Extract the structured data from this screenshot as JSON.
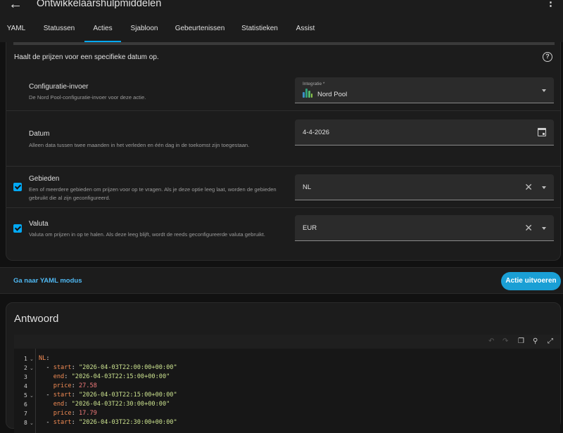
{
  "header": {
    "title": "Ontwikkelaarshulpmiddelen",
    "back_icon": "arrow-left-icon",
    "more_icon": "more-vertical-icon"
  },
  "tabs": [
    {
      "label": "YAML"
    },
    {
      "label": "Statussen"
    },
    {
      "label": "Acties",
      "active": true
    },
    {
      "label": "Sjabloon"
    },
    {
      "label": "Gebeurtenissen"
    },
    {
      "label": "Statistieken"
    },
    {
      "label": "Assist"
    }
  ],
  "action": {
    "description": "Haalt de prijzen voor een specifieke datum op.",
    "fields": {
      "config": {
        "label": "Configuratie-invoer",
        "sub": "De Nord Pool-configuratie-invoer voor deze actie.",
        "float_label": "Integratie *",
        "value": "Nord Pool"
      },
      "date": {
        "label": "Datum",
        "sub": "Alleen data tussen twee maanden in het verleden en één dag in de toekomst zijn toegestaan.",
        "value": "4-4-2026"
      },
      "areas": {
        "label": "Gebieden",
        "sub": "Een of meerdere gebieden om prijzen voor op te vragen. Als je deze optie leeg laat, worden de gebieden gebruikt die al zijn geconfigureerd.",
        "value": "NL",
        "checked": true
      },
      "currency": {
        "label": "Valuta",
        "sub": "Valuta om prijzen in op te halen. Als deze leeg blijft, wordt de reeds geconfigureerde valuta gebruikt.",
        "value": "EUR",
        "checked": true
      }
    }
  },
  "footer": {
    "yaml_link": "Ga naar YAML modus",
    "run_button": "Actie uitvoeren"
  },
  "response": {
    "title": "Antwoord",
    "lines": [
      {
        "n": "1",
        "fold": true,
        "parts": [
          {
            "c": "k",
            "t": "NL"
          },
          {
            "c": "",
            "t": ":"
          }
        ]
      },
      {
        "n": "2",
        "fold": true,
        "parts": [
          {
            "c": "",
            "t": "  - "
          },
          {
            "c": "k",
            "t": "start"
          },
          {
            "c": "",
            "t": ": "
          },
          {
            "c": "s",
            "t": "\"2026-04-03T22:00:00+00:00\""
          }
        ]
      },
      {
        "n": "3",
        "fold": false,
        "parts": [
          {
            "c": "",
            "t": "    "
          },
          {
            "c": "k",
            "t": "end"
          },
          {
            "c": "",
            "t": ": "
          },
          {
            "c": "s",
            "t": "\"2026-04-03T22:15:00+00:00\""
          }
        ]
      },
      {
        "n": "4",
        "fold": false,
        "parts": [
          {
            "c": "",
            "t": "    "
          },
          {
            "c": "k",
            "t": "price"
          },
          {
            "c": "",
            "t": ": "
          },
          {
            "c": "n",
            "t": "27.58"
          }
        ]
      },
      {
        "n": "5",
        "fold": true,
        "parts": [
          {
            "c": "",
            "t": "  - "
          },
          {
            "c": "k",
            "t": "start"
          },
          {
            "c": "",
            "t": ": "
          },
          {
            "c": "s",
            "t": "\"2026-04-03T22:15:00+00:00\""
          }
        ]
      },
      {
        "n": "6",
        "fold": false,
        "parts": [
          {
            "c": "",
            "t": "    "
          },
          {
            "c": "k",
            "t": "end"
          },
          {
            "c": "",
            "t": ": "
          },
          {
            "c": "s",
            "t": "\"2026-04-03T22:30:00+00:00\""
          }
        ]
      },
      {
        "n": "7",
        "fold": false,
        "parts": [
          {
            "c": "",
            "t": "    "
          },
          {
            "c": "k",
            "t": "price"
          },
          {
            "c": "",
            "t": ": "
          },
          {
            "c": "n",
            "t": "17.79"
          }
        ]
      },
      {
        "n": "8",
        "fold": true,
        "parts": [
          {
            "c": "",
            "t": "  - "
          },
          {
            "c": "k",
            "t": "start"
          },
          {
            "c": "",
            "t": ": "
          },
          {
            "c": "s",
            "t": "\"2026-04-03T22:30:00+00:00\""
          }
        ]
      }
    ]
  },
  "colors": {
    "accent": "#03a9f4",
    "run_button": "#1a9fd5",
    "key": "#f28b54",
    "string": "#cbe28f",
    "number": "#f07a7a"
  }
}
